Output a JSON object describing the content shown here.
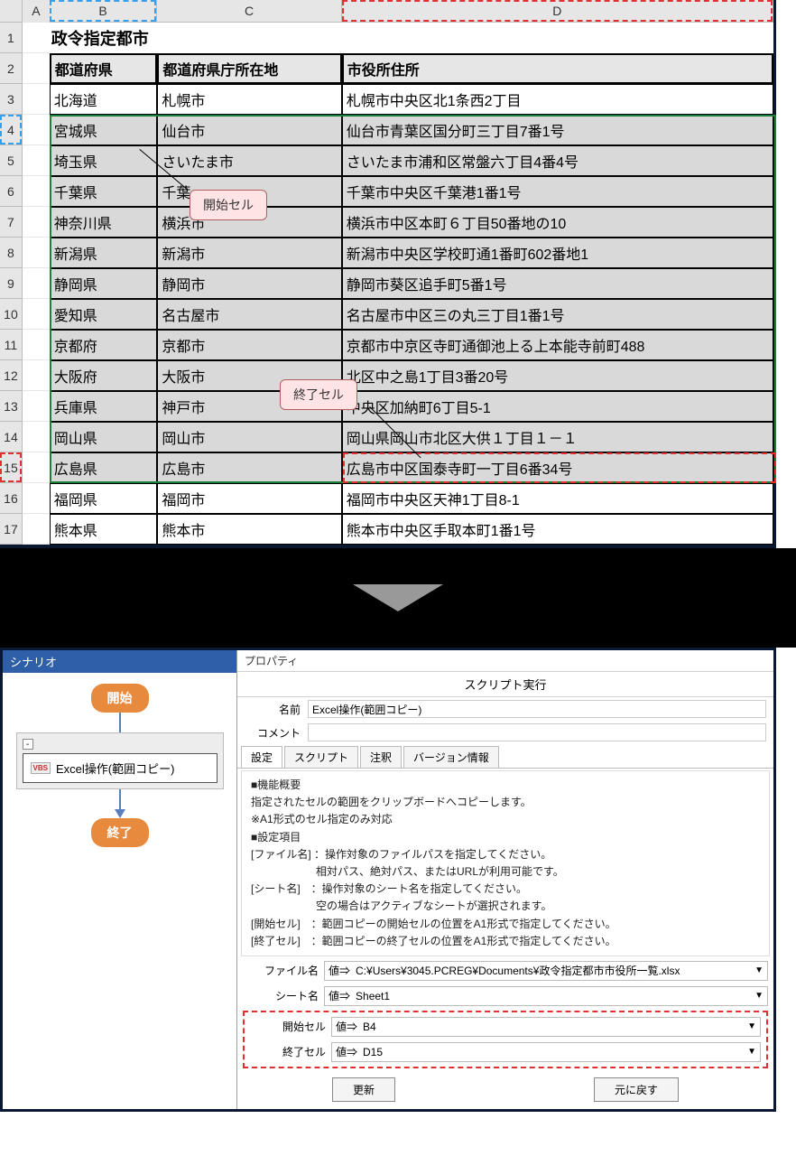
{
  "spreadsheet": {
    "columns": [
      "A",
      "B",
      "C",
      "D"
    ],
    "row_numbers": [
      1,
      2,
      3,
      4,
      5,
      6,
      7,
      8,
      9,
      10,
      11,
      12,
      13,
      14,
      15,
      16,
      17
    ],
    "title": "政令指定都市",
    "headers": {
      "b": "都道府県",
      "c": "都道府県庁所在地",
      "d": "市役所住所"
    },
    "rows": [
      {
        "b": "北海道",
        "c": "札幌市",
        "d": "札幌市中央区北1条西2丁目"
      },
      {
        "b": "宮城県",
        "c": "仙台市",
        "d": "仙台市青葉区国分町三丁目7番1号"
      },
      {
        "b": "埼玉県",
        "c": "さいたま市",
        "d": "さいたま市浦和区常盤六丁目4番4号"
      },
      {
        "b": "千葉県",
        "c": "千葉",
        "d": "千葉市中央区千葉港1番1号"
      },
      {
        "b": "神奈川県",
        "c": "横浜市",
        "d": "横浜市中区本町６丁目50番地の10"
      },
      {
        "b": "新潟県",
        "c": "新潟市",
        "d": "新潟市中央区学校町通1番町602番地1"
      },
      {
        "b": "静岡県",
        "c": "静岡市",
        "d": "静岡市葵区追手町5番1号"
      },
      {
        "b": "愛知県",
        "c": "名古屋市",
        "d": "名古屋市中区三の丸三丁目1番1号"
      },
      {
        "b": "京都府",
        "c": "京都市",
        "d": "京都市中京区寺町通御池上る上本能寺前町488"
      },
      {
        "b": "大阪府",
        "c": "大阪市",
        "d": "北区中之島1丁目3番20号"
      },
      {
        "b": "兵庫県",
        "c": "神戸市",
        "d": "中央区加納町6丁目5-1"
      },
      {
        "b": "岡山県",
        "c": "岡山市",
        "d": "岡山県岡山市北区大供１丁目１－１"
      },
      {
        "b": "広島県",
        "c": "広島市",
        "d": "広島市中区国泰寺町一丁目6番34号"
      },
      {
        "b": "福岡県",
        "c": "福岡市",
        "d": "福岡市中央区天神1丁目8-1"
      },
      {
        "b": "熊本県",
        "c": "熊本市",
        "d": "熊本市中央区手取本町1番1号"
      }
    ]
  },
  "callouts": {
    "start": "開始セル",
    "end": "終了セル"
  },
  "scenario": {
    "title": "シナリオ",
    "start": "開始",
    "end": "終了",
    "card": {
      "vbs": "VBS",
      "label": "Excel操作(範囲コピー)",
      "expander": "-"
    }
  },
  "properties": {
    "title": "プロパティ",
    "subtitle": "スクリプト実行",
    "name_label": "名前",
    "name_value": "Excel操作(範囲コピー)",
    "comment_label": "コメント",
    "comment_value": "",
    "tabs": [
      "設定",
      "スクリプト",
      "注釈",
      "バージョン情報"
    ],
    "desc": [
      "■機能概要",
      "指定されたセルの範囲をクリップボードへコピーします。",
      "",
      "※A1形式のセル指定のみ対応",
      "",
      "■設定項目",
      "[ファイル名] ：操作対象のファイルパスを指定してください。",
      "　　　　　　相対パス、絶対パス、またはURLが利用可能です。",
      "[シート名]　：操作対象のシート名を指定してください。",
      "　　　　　　空の場合はアクティブなシートが選択されます。",
      "[開始セル]　：範囲コピーの開始セルの位置をA1形式で指定してください。",
      "[終了セル]　：範囲コピーの終了セルの位置をA1形式で指定してください。"
    ],
    "params": [
      {
        "label": "ファイル名",
        "prefix": "値⇒",
        "value": "C:¥Users¥3045.PCREG¥Documents¥政令指定都市市役所一覧.xlsx"
      },
      {
        "label": "シート名",
        "prefix": "値⇒",
        "value": "Sheet1"
      },
      {
        "label": "開始セル",
        "prefix": "値⇒",
        "value": "B4"
      },
      {
        "label": "終了セル",
        "prefix": "値⇒",
        "value": "D15"
      }
    ],
    "buttons": {
      "update": "更新",
      "revert": "元に戻す"
    }
  }
}
